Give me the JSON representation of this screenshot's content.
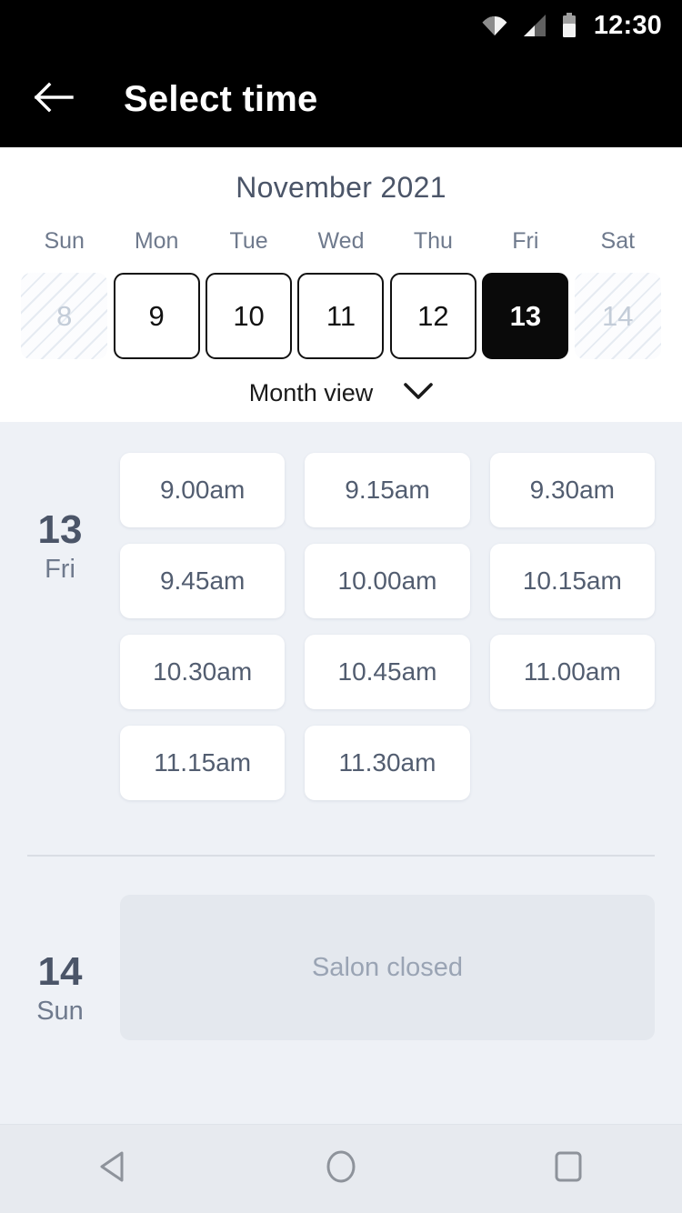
{
  "status_bar": {
    "time": "12:30",
    "icons": [
      "wifi-icon",
      "signal-icon",
      "battery-icon"
    ]
  },
  "app_bar": {
    "back_icon": "back-arrow-icon",
    "title": "Select time"
  },
  "calendar": {
    "month_title": "November 2021",
    "weekdays": [
      "Sun",
      "Mon",
      "Tue",
      "Wed",
      "Thu",
      "Fri",
      "Sat"
    ],
    "days": [
      {
        "number": "8",
        "state": "disabled"
      },
      {
        "number": "9",
        "state": "available"
      },
      {
        "number": "10",
        "state": "available"
      },
      {
        "number": "11",
        "state": "available"
      },
      {
        "number": "12",
        "state": "available"
      },
      {
        "number": "13",
        "state": "selected"
      },
      {
        "number": "14",
        "state": "disabled"
      }
    ],
    "view_toggle": {
      "label": "Month view",
      "icon": "chevron-down-icon"
    }
  },
  "schedule": {
    "groups": [
      {
        "day_number": "13",
        "day_of_week": "Fri",
        "slots": [
          "9.00am",
          "9.15am",
          "9.30am",
          "9.45am",
          "10.00am",
          "10.15am",
          "10.30am",
          "10.45am",
          "11.00am",
          "11.15am",
          "11.30am"
        ]
      },
      {
        "day_number": "14",
        "day_of_week": "Sun",
        "closed_message": "Salon closed"
      }
    ]
  },
  "nav_bar": {
    "back": "nav-back-icon",
    "home": "nav-home-icon",
    "recents": "nav-recents-icon"
  },
  "colors": {
    "app_bar_bg": "#000000",
    "selected_day_bg": "#0a0a0a",
    "slots_area_bg": "#eef1f6",
    "slot_card_bg": "#ffffff",
    "closed_card_bg": "#e4e8ee",
    "heading_text": "#4b5568",
    "muted_text": "#6f7a8d",
    "nav_bar_bg": "#e7eaef"
  }
}
